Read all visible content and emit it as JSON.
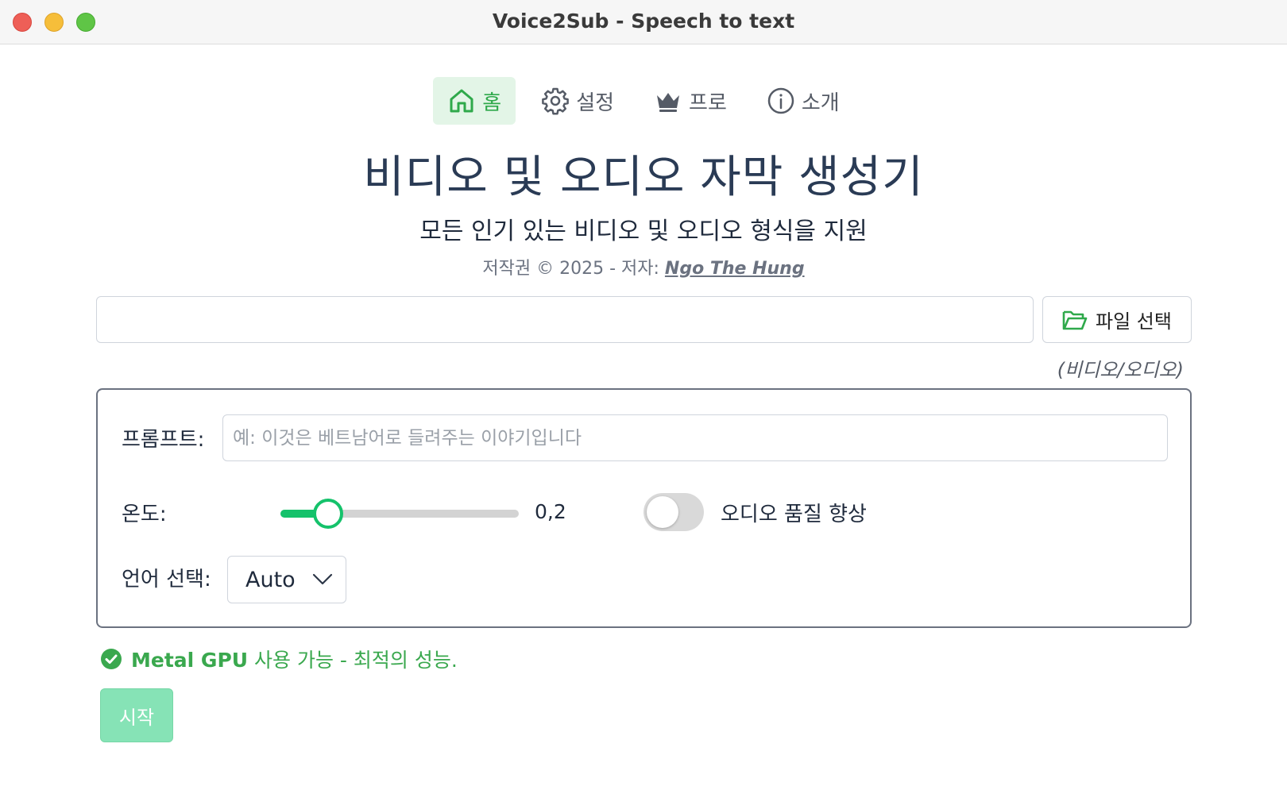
{
  "window": {
    "title": "Voice2Sub - Speech to text"
  },
  "nav": {
    "items": [
      {
        "label": "홈",
        "icon": "home-icon",
        "active": true
      },
      {
        "label": "설정",
        "icon": "gear-icon",
        "active": false
      },
      {
        "label": "프로",
        "icon": "crown-icon",
        "active": false
      },
      {
        "label": "소개",
        "icon": "info-icon",
        "active": false
      }
    ]
  },
  "header": {
    "title": "비디오 및 오디오 자막 생성기",
    "subtitle": "모든 인기 있는 비디오 및 오디오 형식을 지원",
    "copyright_prefix": "저작권 © 2025 - 저자: ",
    "author": "Ngo The Hung"
  },
  "file": {
    "path_value": "",
    "select_button_label": "파일 선택",
    "hint": "(비디오/오디오)"
  },
  "settings": {
    "prompt_label": "프롬프트:",
    "prompt_placeholder": "예: 이것은 베트남어로 들려주는 이야기입니다",
    "prompt_value": "",
    "temperature_label": "온도:",
    "temperature_value": "0,2",
    "temperature_fraction": 0.2,
    "enhance_label": "오디오 품질 향상",
    "enhance_enabled": false,
    "language_label": "언어 선택:",
    "language_value": "Auto"
  },
  "status": {
    "strong": "Metal GPU",
    "text": " 사용 가능 - 최적의 성능."
  },
  "actions": {
    "start_label": "시작"
  },
  "colors": {
    "accent_green": "#2fa94b",
    "slider_green": "#15c26b",
    "start_disabled": "#86e3b6",
    "title_text": "#2a3b55"
  }
}
